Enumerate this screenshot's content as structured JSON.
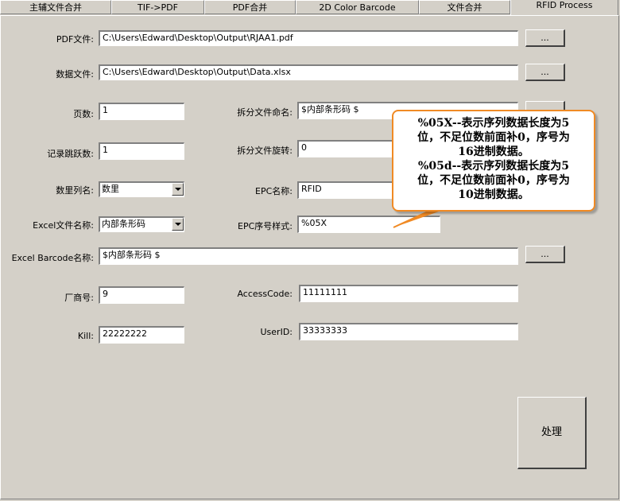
{
  "tabs": [
    {
      "label": "主辅文件合并"
    },
    {
      "label": "TIF->PDF"
    },
    {
      "label": "PDF合并"
    },
    {
      "label": "2D Color Barcode"
    },
    {
      "label": "文件合并"
    },
    {
      "label": "RFID Process"
    }
  ],
  "form": {
    "pdf_label": "PDF文件:",
    "pdf_value": "C:\\Users\\Edward\\Desktop\\Output\\RJAA1.pdf",
    "data_label": "数据文件:",
    "data_value": "C:\\Users\\Edward\\Desktop\\Output\\Data.xlsx",
    "browse_label": "...",
    "pages_label": "页数:",
    "pages_value": "1",
    "split_name_label": "拆分文件命名:",
    "split_name_value": "$内部条形码 $",
    "record_skip_label": "记录跳跃数:",
    "record_skip_value": "1",
    "split_rotate_label": "拆分文件旋转:",
    "split_rotate_value": "0",
    "qty_col_label": "数里列名:",
    "qty_col_value": "数里",
    "epc_name_label": "EPC名称:",
    "epc_name_value": "RFID",
    "excel_file_label": "Excel文件名称:",
    "excel_file_value": "内部条形码",
    "epc_seq_label": "EPC序号样式:",
    "epc_seq_value": "%05X",
    "excel_barcode_label": "Excel Barcode名称:",
    "excel_barcode_value": "$内部条形码 $",
    "vendor_label": "厂商号:",
    "vendor_value": "9",
    "access_label": "AccessCode:",
    "access_value": "11111111",
    "kill_label": "Kill:",
    "kill_value": "22222222",
    "userid_label": "UserID:",
    "userid_value": "33333333",
    "process_label": "处理"
  },
  "callout": {
    "line1": "%05X--表示序列数据长度为5",
    "line2": "位，不足位数前面补0，序号为",
    "line3": "16进制数据。",
    "line4": "%05d--表示序列数据长度为5",
    "line5": "位，不足位数前面补0，序号为",
    "line6": "10进制数据。"
  },
  "colors": {
    "background": "#d4d0c8",
    "callout_border": "#f08a24"
  }
}
